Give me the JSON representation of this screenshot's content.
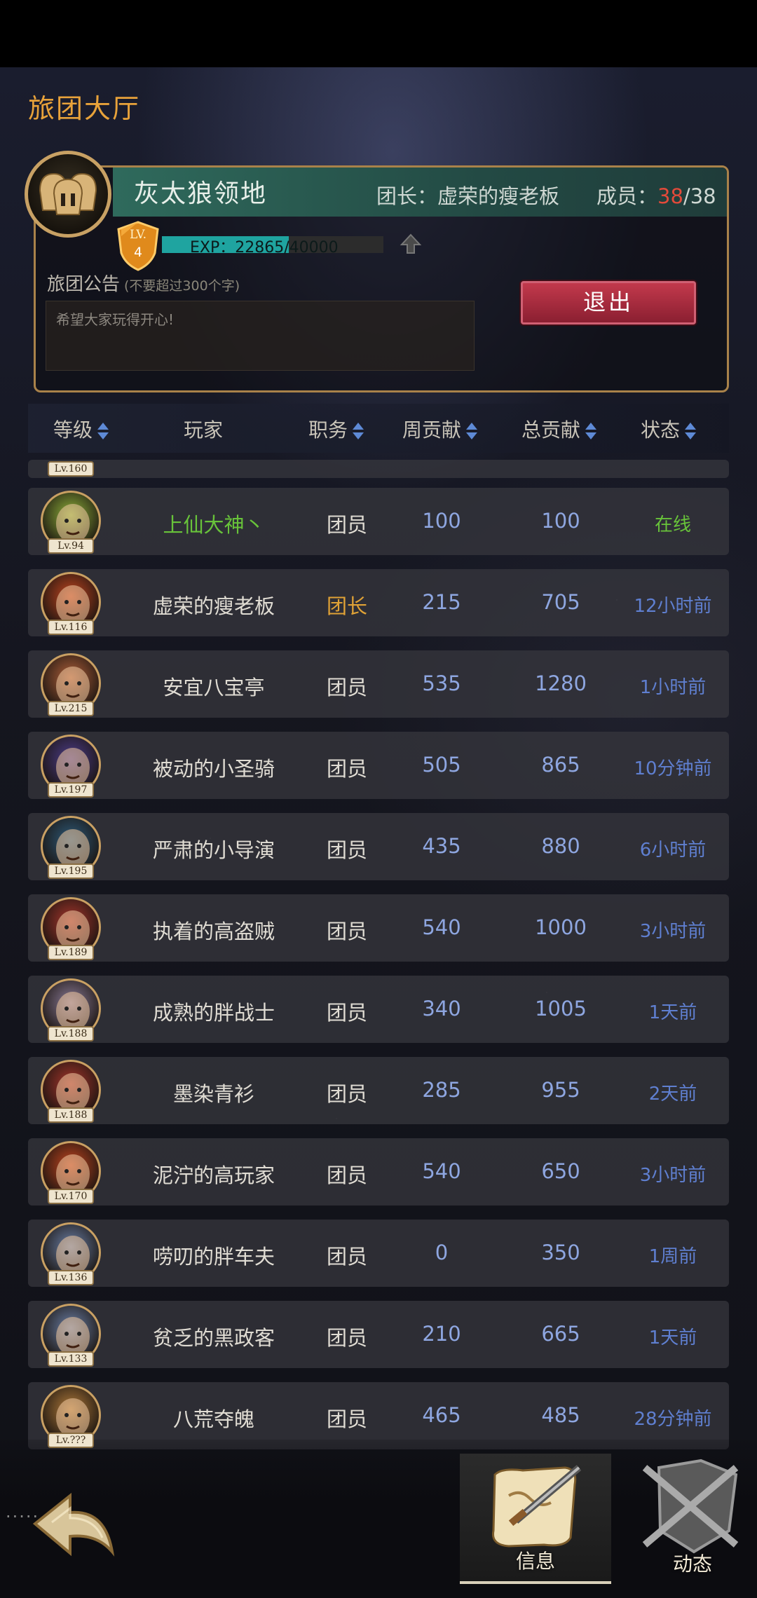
{
  "page": {
    "title": "旅团大厅"
  },
  "guild": {
    "name": "灰太狼领地",
    "leader_label": "团长：虚荣的瘦老板",
    "members_label": "成员：",
    "members_count": "38",
    "members_max": "/38",
    "level_label": "LV.",
    "level": "4",
    "exp_text": "EXP：22865/40000",
    "exp_progress": 0.5716,
    "notice_label": "旅团公告",
    "notice_hint": "(不要超过300个字)",
    "notice_text": "希望大家玩得开心!",
    "quit_label": "退出"
  },
  "table": {
    "headers": {
      "level": "等级",
      "player": "玩家",
      "role": "职务",
      "weekly": "周贡献",
      "total": "总贡献",
      "status": "状态"
    }
  },
  "partial_row": {
    "level": "Lv.160"
  },
  "members": [
    {
      "level": "Lv.94",
      "name": "上仙大神丶",
      "role": "团员",
      "weekly": "100",
      "total": "100",
      "status": "在线",
      "avatar_color": "#8fb03a"
    },
    {
      "level": "Lv.116",
      "name": "虚荣的瘦老板",
      "role": "团长",
      "weekly": "215",
      "total": "705",
      "status": "12小时前",
      "avatar_color": "#c2451f"
    },
    {
      "level": "Lv.215",
      "name": "安宜八宝亭",
      "role": "团员",
      "weekly": "535",
      "total": "1280",
      "status": "1小时前",
      "avatar_color": "#b0603a"
    },
    {
      "level": "Lv.197",
      "name": "被动的小圣骑",
      "role": "团员",
      "weekly": "505",
      "total": "865",
      "status": "10分钟前",
      "avatar_color": "#4c3c8a"
    },
    {
      "level": "Lv.195",
      "name": "严肃的小导演",
      "role": "团员",
      "weekly": "435",
      "total": "880",
      "status": "6小时前",
      "avatar_color": "#2d5a7a"
    },
    {
      "level": "Lv.189",
      "name": "执着的高盗贼",
      "role": "团员",
      "weekly": "540",
      "total": "1000",
      "status": "3小时前",
      "avatar_color": "#a8362c"
    },
    {
      "level": "Lv.188",
      "name": "成熟的胖战士",
      "role": "团员",
      "weekly": "340",
      "total": "1005",
      "status": "1天前",
      "avatar_color": "#8a7a96"
    },
    {
      "level": "Lv.188",
      "name": "墨染青衫",
      "role": "团员",
      "weekly": "285",
      "total": "955",
      "status": "2天前",
      "avatar_color": "#a8362c"
    },
    {
      "level": "Lv.170",
      "name": "泥泞的高玩家",
      "role": "团员",
      "weekly": "540",
      "total": "650",
      "status": "3小时前",
      "avatar_color": "#c2451f"
    },
    {
      "level": "Lv.136",
      "name": "唠叨的胖车夫",
      "role": "团员",
      "weekly": "0",
      "total": "350",
      "status": "1周前",
      "avatar_color": "#6a7fa6"
    },
    {
      "level": "Lv.133",
      "name": "贫乏的黑政客",
      "role": "团员",
      "weekly": "210",
      "total": "665",
      "status": "1天前",
      "avatar_color": "#6a7fa6"
    },
    {
      "level": "Lv.???",
      "name": "八荒夺魄",
      "role": "团员",
      "weekly": "465",
      "total": "485",
      "status": "28分钟前",
      "avatar_color": "#b07a3a"
    }
  ],
  "bottom": {
    "tab_info": "信息",
    "tab_news": "动态",
    "back_dots": "·····"
  },
  "colors": {
    "accent": "#e8a23a",
    "online": "#68c33a",
    "leader": "#e0a236",
    "quit": "#b0303f",
    "status_blue": "#5f7fd0"
  }
}
